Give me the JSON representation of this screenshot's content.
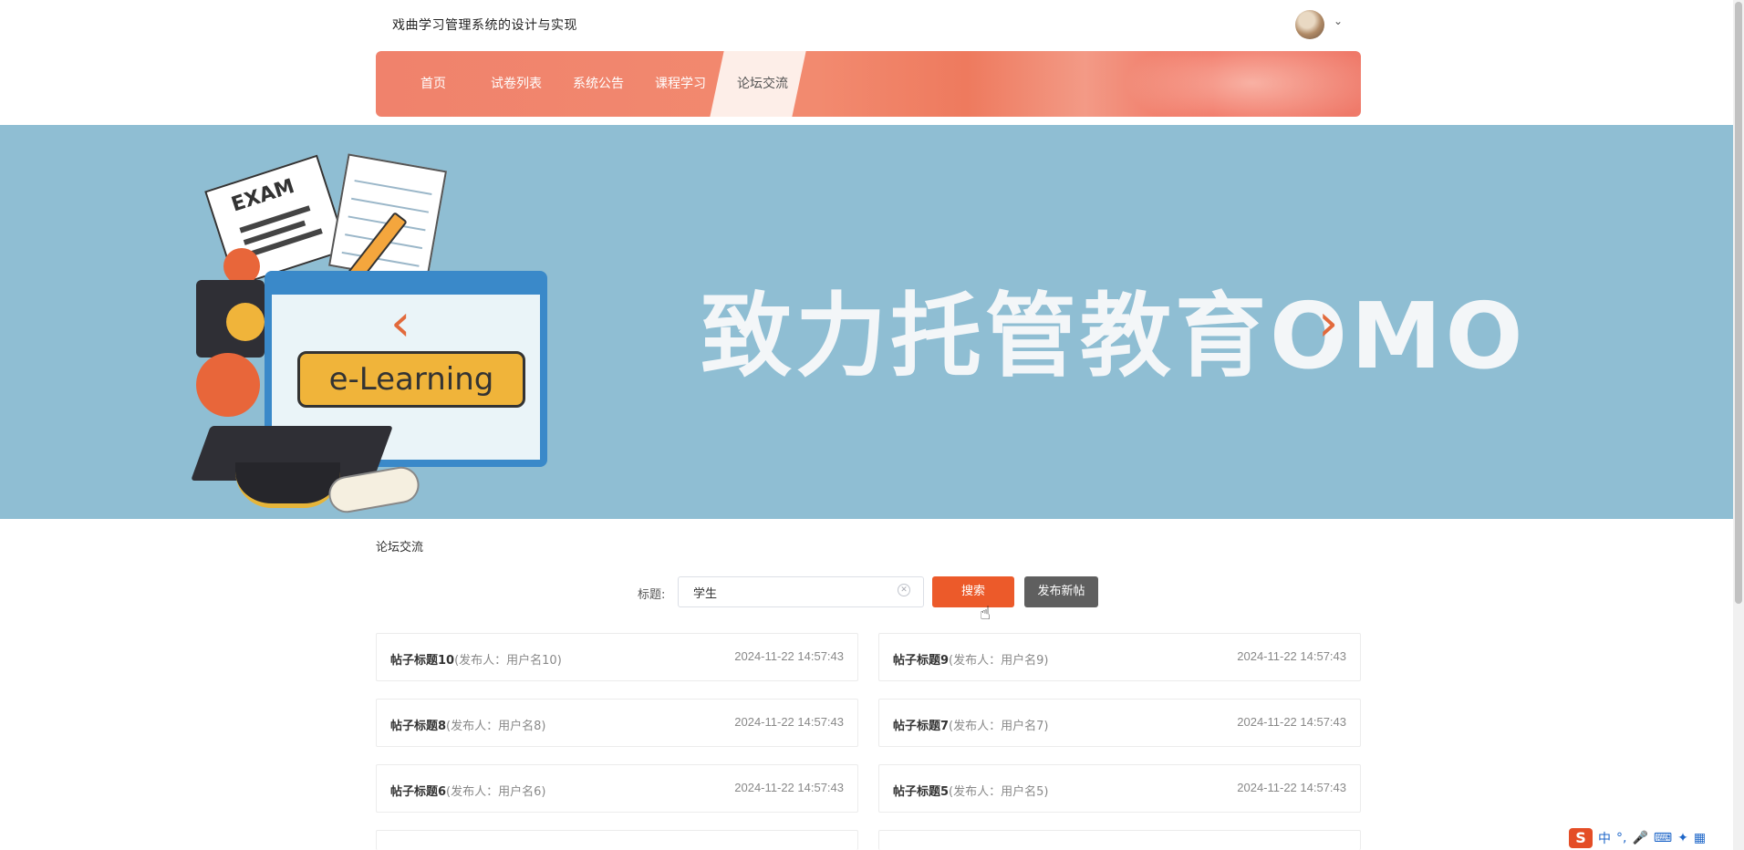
{
  "header": {
    "site_title": "戏曲学习管理系统的设计与实现",
    "avatar_icon": "user-avatar",
    "dropdown_icon": "chevron-down-icon"
  },
  "nav": {
    "items": [
      {
        "label": "首页"
      },
      {
        "label": "试卷列表"
      },
      {
        "label": "系统公告"
      },
      {
        "label": "课程学习"
      },
      {
        "label": "论坛交流"
      }
    ],
    "active_index": 4
  },
  "banner": {
    "headline": "致力托管教育OMO",
    "exam_label": "EXAM",
    "button_label": "e-Learning",
    "prev_icon": "chevron-left-icon",
    "next_icon": "chevron-right-icon"
  },
  "breadcrumb": "论坛交流",
  "search": {
    "label": "标题:",
    "value": "学生",
    "search_button": "搜索",
    "post_button": "发布新帖"
  },
  "posts": [
    {
      "title": "帖子标题10",
      "author": "(发布人：用户名10)",
      "time": "2024-11-22 14:57:43"
    },
    {
      "title": "帖子标题9",
      "author": "(发布人：用户名9)",
      "time": "2024-11-22 14:57:43"
    },
    {
      "title": "帖子标题8",
      "author": "(发布人：用户名8)",
      "time": "2024-11-22 14:57:43"
    },
    {
      "title": "帖子标题7",
      "author": "(发布人：用户名7)",
      "time": "2024-11-22 14:57:43"
    },
    {
      "title": "帖子标题6",
      "author": "(发布人：用户名6)",
      "time": "2024-11-22 14:57:43"
    },
    {
      "title": "帖子标题5",
      "author": "(发布人：用户名5)",
      "time": "2024-11-22 14:57:43"
    }
  ],
  "ime": {
    "logo": "S",
    "mode": "中"
  },
  "colors": {
    "accent": "#ec5a2a",
    "banner_bg": "#8fbed3",
    "nav_bg": "#f0826c"
  }
}
